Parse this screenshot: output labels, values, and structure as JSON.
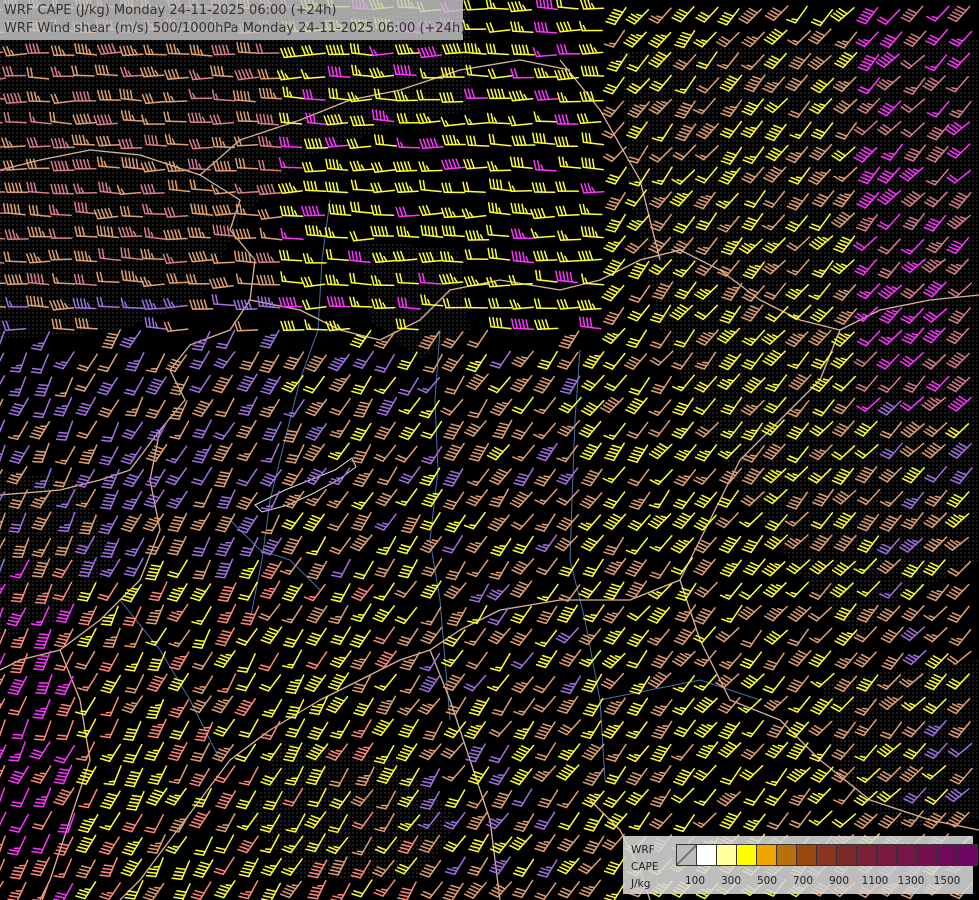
{
  "header": {
    "line1": "WRF CAPE (J/kg) Monday 24-11-2025 06:00 (+24h)",
    "line2": "WRF Wind shear (m/s) 500/1000hPa Monday 24-11-2025 06:00 (+24h)"
  },
  "legend": {
    "title": "WRF",
    "quantity": "CAPE",
    "unit": "J/kg",
    "colors": [
      "#000000",
      "#ffffff",
      "#ffff99",
      "#ffff00",
      "#f0a500",
      "#b8700a",
      "#9a4a10",
      "#8b3520",
      "#7f2a2a",
      "#7c2035",
      "#7a1a40",
      "#781548",
      "#741050",
      "#700a58",
      "#6c0660"
    ],
    "ticks": [
      "100",
      "300",
      "500",
      "700",
      "900",
      "1100",
      "1300",
      "1500"
    ]
  },
  "palette": {
    "background": "#000000",
    "border": "#d8b49a",
    "river": "#4d6fa8",
    "barb_yellow": "#ffff33",
    "barb_tan": "#e0a070",
    "barb_salmon": "#ff8878",
    "barb_magenta": "#ff33ff",
    "barb_violet": "#a070e0",
    "barb_pink": "#d87c8a"
  }
}
